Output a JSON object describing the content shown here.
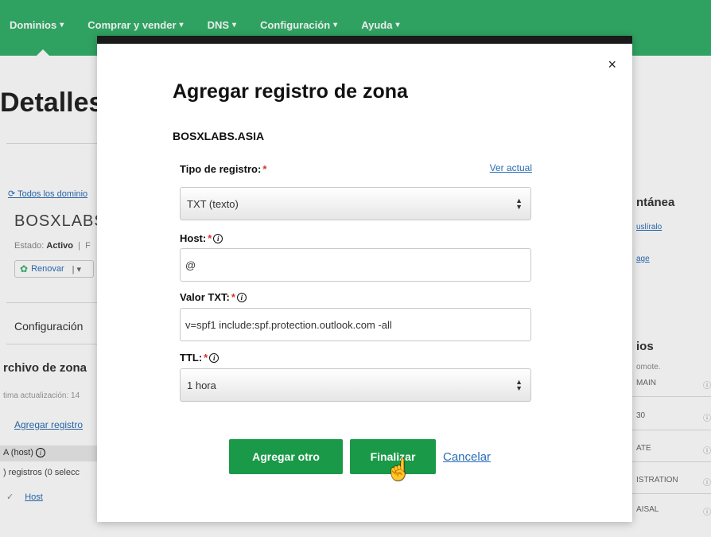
{
  "topnav": {
    "items": [
      {
        "label": "Dominios"
      },
      {
        "label": "Comprar y vender"
      },
      {
        "label": "DNS"
      },
      {
        "label": "Configuración"
      },
      {
        "label": "Ayuda"
      }
    ]
  },
  "background": {
    "title": "Detalles",
    "all_domains_link": "Todos los dominio",
    "domain": "BOSXLABS",
    "estado_label": "Estado:",
    "estado_value": "Activo",
    "renovar": "Renovar",
    "configuracion": "Configuración",
    "archivo_zona": "rchivo de zona",
    "ultima_actualizacion": "tima actualización: 14",
    "agregar_registro": "Agregar registro",
    "a_host": "A (host)",
    "registros": ") registros (0 selecc",
    "host_col": "Host",
    "right_title1": "ntánea",
    "right_link1": "uslíralo",
    "right_link2": "age",
    "right_title2": "ios",
    "right_small": "omote.",
    "right_rows": [
      "MAIN",
      "30",
      "ATE",
      "ISTRATION",
      "AISAL"
    ]
  },
  "modal": {
    "title": "Agregar registro de zona",
    "domain": "BOSXLABS.ASIA",
    "close": "×",
    "tipo_label": "Tipo de registro:",
    "ver_actual": "Ver actual",
    "tipo_value": "TXT (texto)",
    "host_label": "Host:",
    "host_value": "@",
    "valor_label": "Valor TXT:",
    "valor_value": "v=spf1 include:spf.protection.outlook.com -all",
    "ttl_label": "TTL:",
    "ttl_value": "1 hora",
    "required_mark": "*",
    "agregar_otro": "Agregar otro",
    "finalizar": "Finalizar",
    "cancelar": "Cancelar"
  },
  "colors": {
    "brand_green": "#33b06a",
    "button_green": "#1a9a48",
    "link_blue": "#2a6db5",
    "required_red": "#d93030"
  }
}
